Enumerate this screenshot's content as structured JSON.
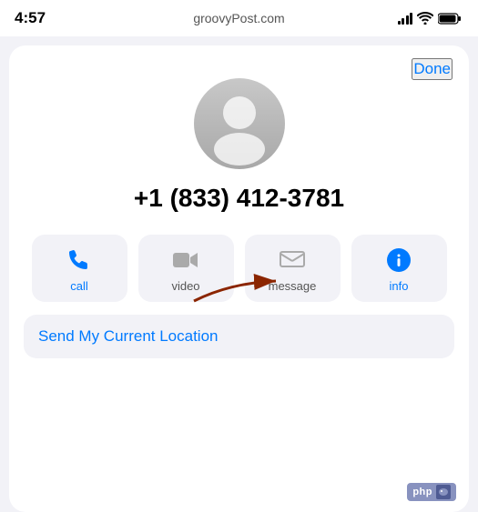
{
  "statusBar": {
    "time": "4:57",
    "site": "groovyPost.com"
  },
  "header": {
    "done_label": "Done"
  },
  "contact": {
    "phone_number": "+1 (833) 412-3781"
  },
  "actions": [
    {
      "id": "call",
      "label": "call",
      "color": "blue"
    },
    {
      "id": "video",
      "label": "video",
      "color": "gray"
    },
    {
      "id": "message",
      "label": "message",
      "color": "gray"
    },
    {
      "id": "info",
      "label": "info",
      "color": "blue"
    }
  ],
  "locationButton": {
    "label": "Send My Current Location"
  },
  "phpBadge": {
    "text": "php"
  }
}
